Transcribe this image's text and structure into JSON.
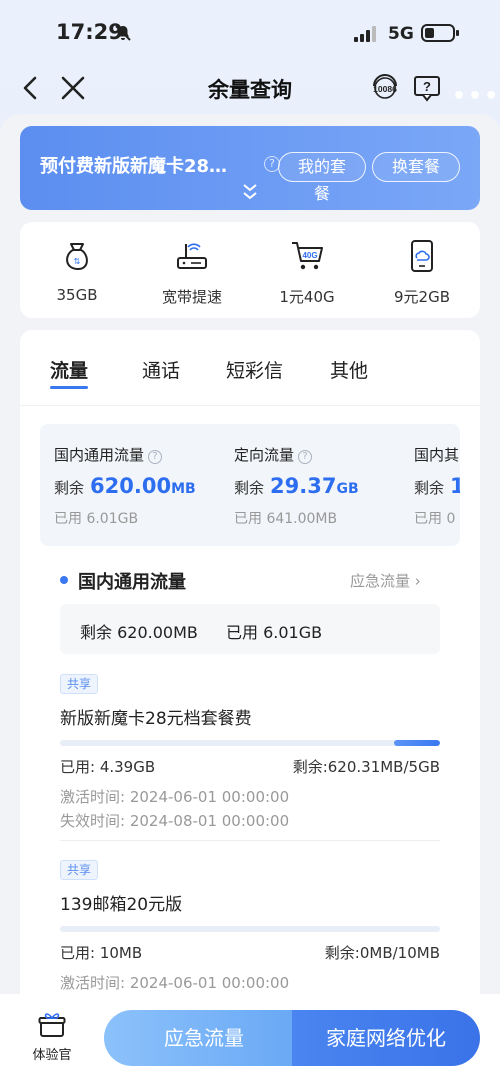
{
  "status_bar": {
    "time": "17:29",
    "network": "5G"
  },
  "nav": {
    "title": "余量查询",
    "service_number": "10086"
  },
  "plan": {
    "name": "预付费新版新魔卡28…",
    "my_plan": "我的套餐",
    "change_plan": "换套餐"
  },
  "quick": [
    {
      "label": "35GB",
      "icon": "money-bag-icon"
    },
    {
      "label": "宽带提速",
      "icon": "router-icon"
    },
    {
      "label": "1元40G",
      "icon": "cart-40g-icon"
    },
    {
      "label": "9元2GB",
      "icon": "phone-cloud-icon"
    }
  ],
  "tabs": [
    "流量",
    "通话",
    "短彩信",
    "其他"
  ],
  "summary": [
    {
      "title": "国内通用流量",
      "remain_label": "剩余",
      "remain_value": "620.00",
      "remain_unit": "MB",
      "used": "已用  6.01GB"
    },
    {
      "title": "定向流量",
      "remain_label": "剩余",
      "remain_value": "29.37",
      "remain_unit": "GB",
      "used": "已用  641.00MB"
    },
    {
      "title": "国内其",
      "remain_label": "剩余",
      "remain_value": "1",
      "remain_unit": "",
      "used": "已用  0"
    }
  ],
  "section": {
    "title": "国内通用流量",
    "emergency_link": "应急流量",
    "remain": "剩余 620.00MB",
    "used": "已用 6.01GB"
  },
  "packages": [
    {
      "tag": "共享",
      "name": "新版新魔卡28元档套餐费",
      "used": "已用: 4.39GB",
      "left": "剩余:620.31MB/5GB",
      "remain_fraction": 0.12,
      "activate": "激活时间: 2024-06-01 00:00:00",
      "expire": "失效时间: 2024-08-01 00:00:00"
    },
    {
      "tag": "共享",
      "name": "139邮箱20元版",
      "used": "已用: 10MB",
      "left": "剩余:0MB/10MB",
      "remain_fraction": 0,
      "activate": "激活时间: 2024-06-01 00:00:00"
    }
  ],
  "bottom": {
    "trial": "体验官",
    "emergency": "应急流量",
    "family": "家庭网络优化"
  },
  "colors": {
    "accent": "#3a78f2",
    "banner": "#6a9bf3"
  }
}
